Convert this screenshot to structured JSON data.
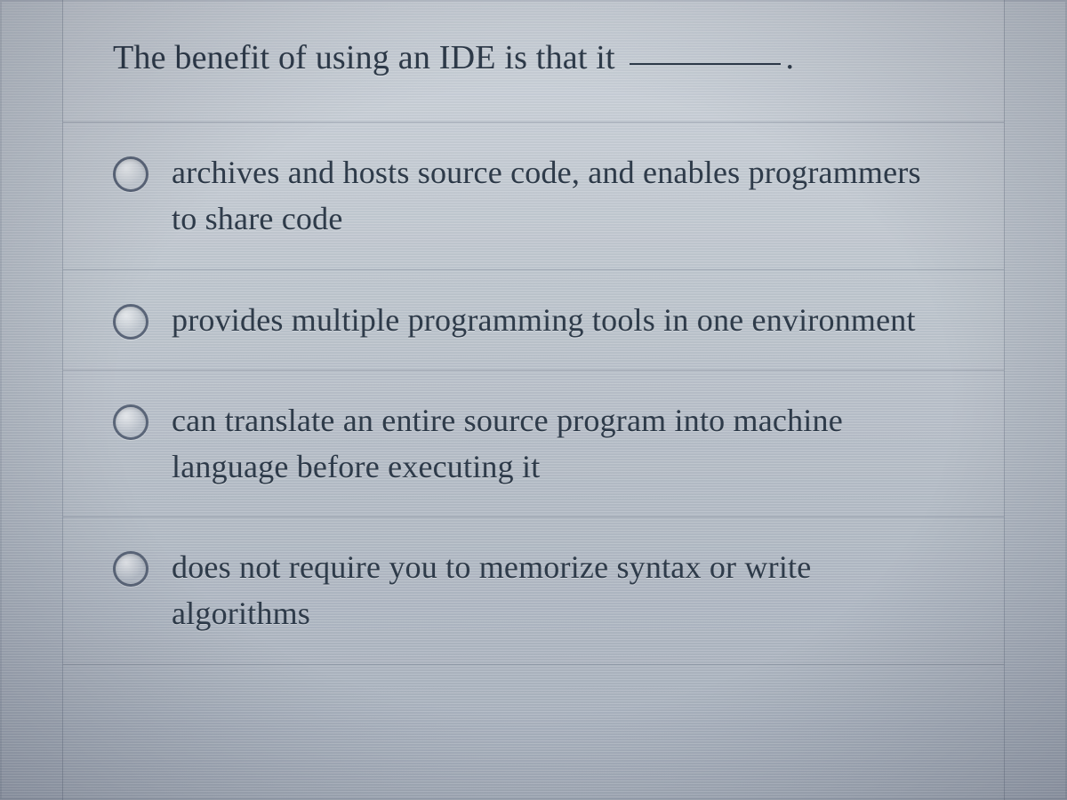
{
  "question": {
    "stem_prefix": "The benefit of using an IDE is that it ",
    "stem_suffix": "."
  },
  "options": [
    {
      "label": "archives and hosts source code, and enables programmers to share code"
    },
    {
      "label": "provides multiple programming tools in one environment"
    },
    {
      "label": "can translate an entire source program into machine language before executing it"
    },
    {
      "label": "does not require you to memorize syntax or write algorithms"
    }
  ]
}
